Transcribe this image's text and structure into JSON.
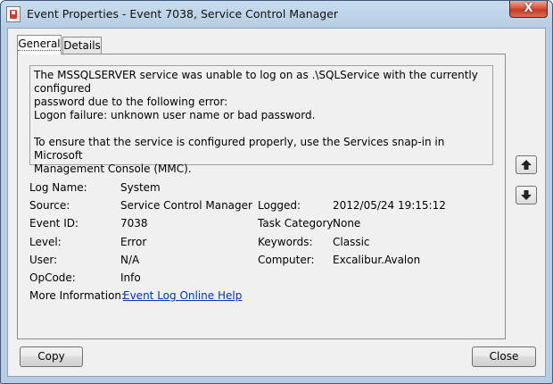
{
  "window": {
    "title": "Event Properties - Event 7038, Service Control Manager",
    "close_glyph": "X"
  },
  "tabs": [
    {
      "label": "General"
    },
    {
      "label": "Details"
    }
  ],
  "description": {
    "line1": "The MSSQLSERVER service was unable to log on as .\\SQLService with the currently configured",
    "line2": "password due to the following error:",
    "line3": "Logon failure: unknown user name or bad password.",
    "line4": "To ensure that the service is configured properly, use the Services snap-in in Microsoft",
    "line5": "Management Console (MMC)."
  },
  "fields": {
    "log_name": {
      "label": "Log Name:",
      "value": "System"
    },
    "source": {
      "label": "Source:",
      "value": "Service Control Manager"
    },
    "logged": {
      "label": "Logged:",
      "value": "2012/05/24 19:15:12"
    },
    "event_id": {
      "label": "Event ID:",
      "value": "7038"
    },
    "task_category": {
      "label": "Task Category:",
      "value": "None"
    },
    "level": {
      "label": "Level:",
      "value": "Error"
    },
    "keywords": {
      "label": "Keywords:",
      "value": "Classic"
    },
    "user": {
      "label": "User:",
      "value": "N/A"
    },
    "computer": {
      "label": "Computer:",
      "value": "Excalibur.Avalon"
    },
    "opcode": {
      "label": "OpCode:",
      "value": "Info"
    },
    "more_info": {
      "label": "More Information:",
      "link": "Event Log Online Help"
    }
  },
  "buttons": {
    "copy": "Copy",
    "close": "Close"
  },
  "icons": {
    "up": "arrow-up-icon",
    "down": "arrow-down-icon",
    "app": "event-viewer-icon"
  }
}
